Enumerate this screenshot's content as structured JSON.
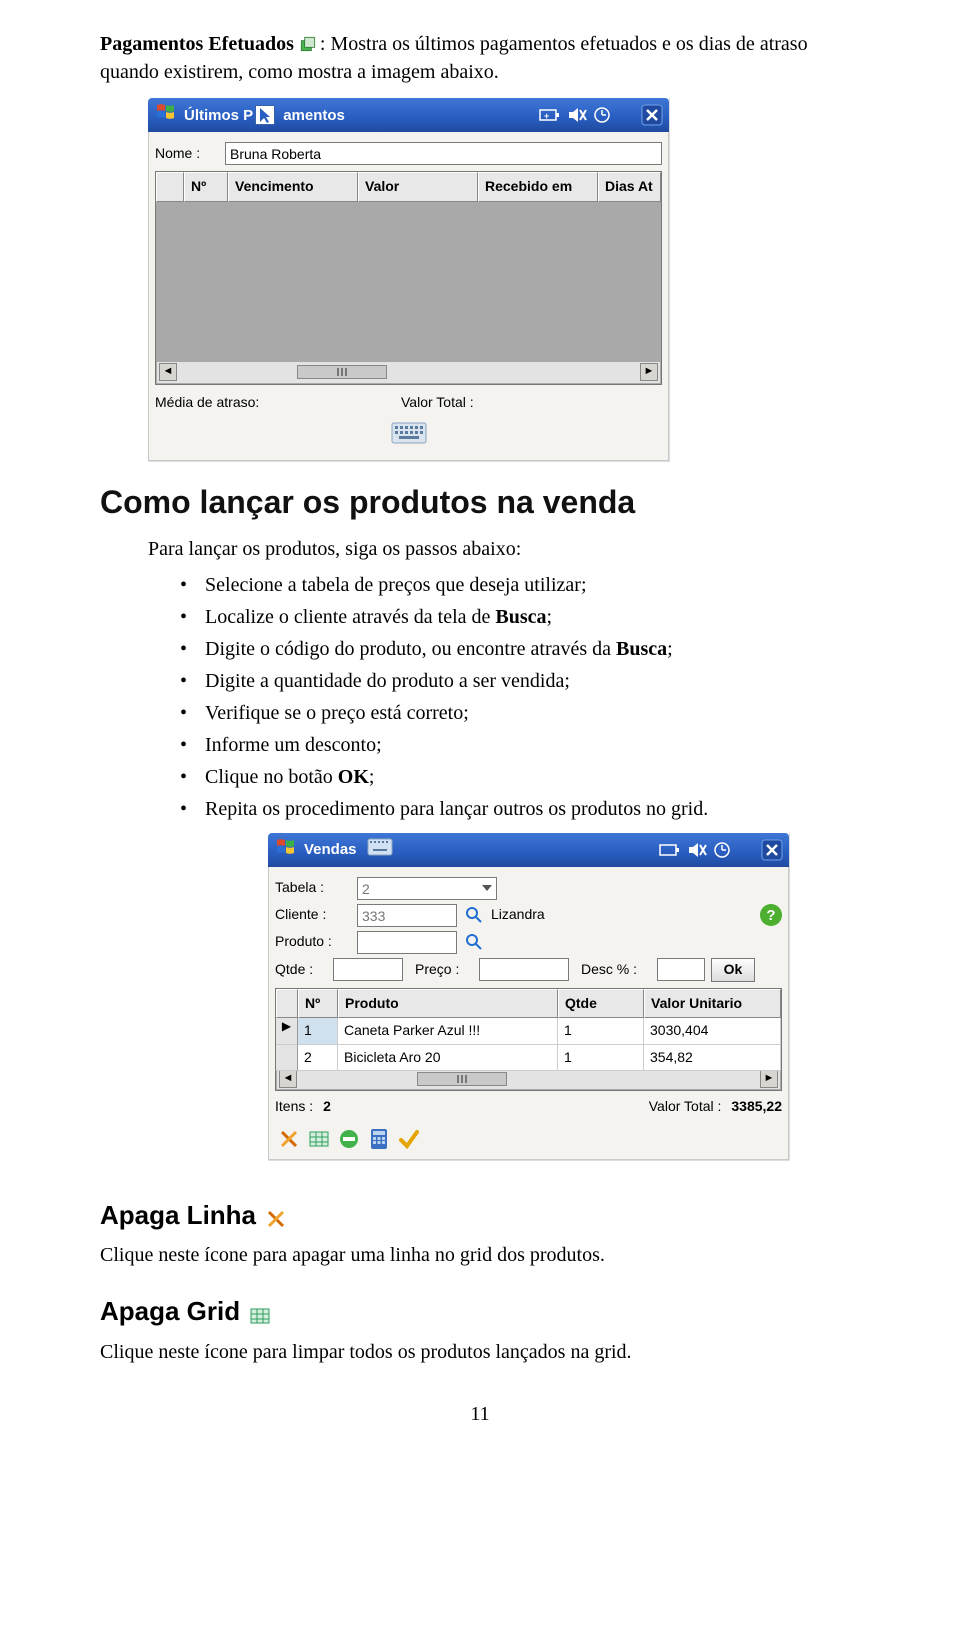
{
  "intro": {
    "lead_bold": "Pagamentos Efetuados",
    "lead_icon_name": "paper-stack-icon",
    "lead_rest": ": Mostra os últimos pagamentos efetuados e os dias de atraso quando existirem, como mostra a imagem abaixo."
  },
  "win1": {
    "title_full": "Últimos Pagamentos",
    "title_visible_left": "Últimos P",
    "title_visible_right": "amentos",
    "nome_label": "Nome :",
    "nome_value": "Bruna Roberta",
    "cols": [
      "Nº",
      "Vencimento",
      "Valor",
      "Recebido em",
      "Dias At"
    ],
    "media_label": "Média de atraso:",
    "total_label": "Valor Total :"
  },
  "section": {
    "heading": "Como lançar os produtos na venda",
    "intro": "Para lançar os produtos, siga os passos abaixo:",
    "bullets": [
      "Selecione a tabela de preços que deseja utilizar;",
      "Localize o cliente através da tela de Busca;",
      "Digite o código do produto, ou encontre através da Busca;",
      "Digite a quantidade do produto a ser vendida;",
      "Verifique se o preço está correto;",
      "Informe um desconto;",
      "Clique no botão OK;",
      "Repita os procedimento para lançar outros os produtos no grid."
    ]
  },
  "win2": {
    "title": "Vendas",
    "labels": {
      "tabela": "Tabela :",
      "cliente": "Cliente :",
      "produto": "Produto :",
      "qtde": "Qtde :",
      "preco": "Preço :",
      "desc": "Desc % :",
      "ok": "Ok"
    },
    "values": {
      "tabela": "2",
      "cliente_code": "333",
      "cliente_name": "Lizandra",
      "produto": "",
      "qtde": "",
      "preco": "",
      "desc": ""
    },
    "cols": [
      "Nº",
      "Produto",
      "Qtde",
      "Valor Unitario"
    ],
    "rows": [
      {
        "no": "1",
        "produto": "Caneta Parker Azul !!!",
        "qtde": "1",
        "valor": "3030,404"
      },
      {
        "no": "2",
        "produto": "Bicicleta Aro 20",
        "qtde": "1",
        "valor": "354,82"
      }
    ],
    "footer": {
      "itens_label": "Itens :",
      "itens_value": "2",
      "total_label": "Valor Total :",
      "total_value": "3385,22"
    }
  },
  "apaga_linha": {
    "heading": "Apaga Linha",
    "text": "Clique neste ícone para apagar uma linha no grid dos produtos."
  },
  "apaga_grid": {
    "heading": "Apaga Grid",
    "text": "Clique neste ícone para limpar todos os produtos lançados na grid."
  },
  "page_number": "11"
}
